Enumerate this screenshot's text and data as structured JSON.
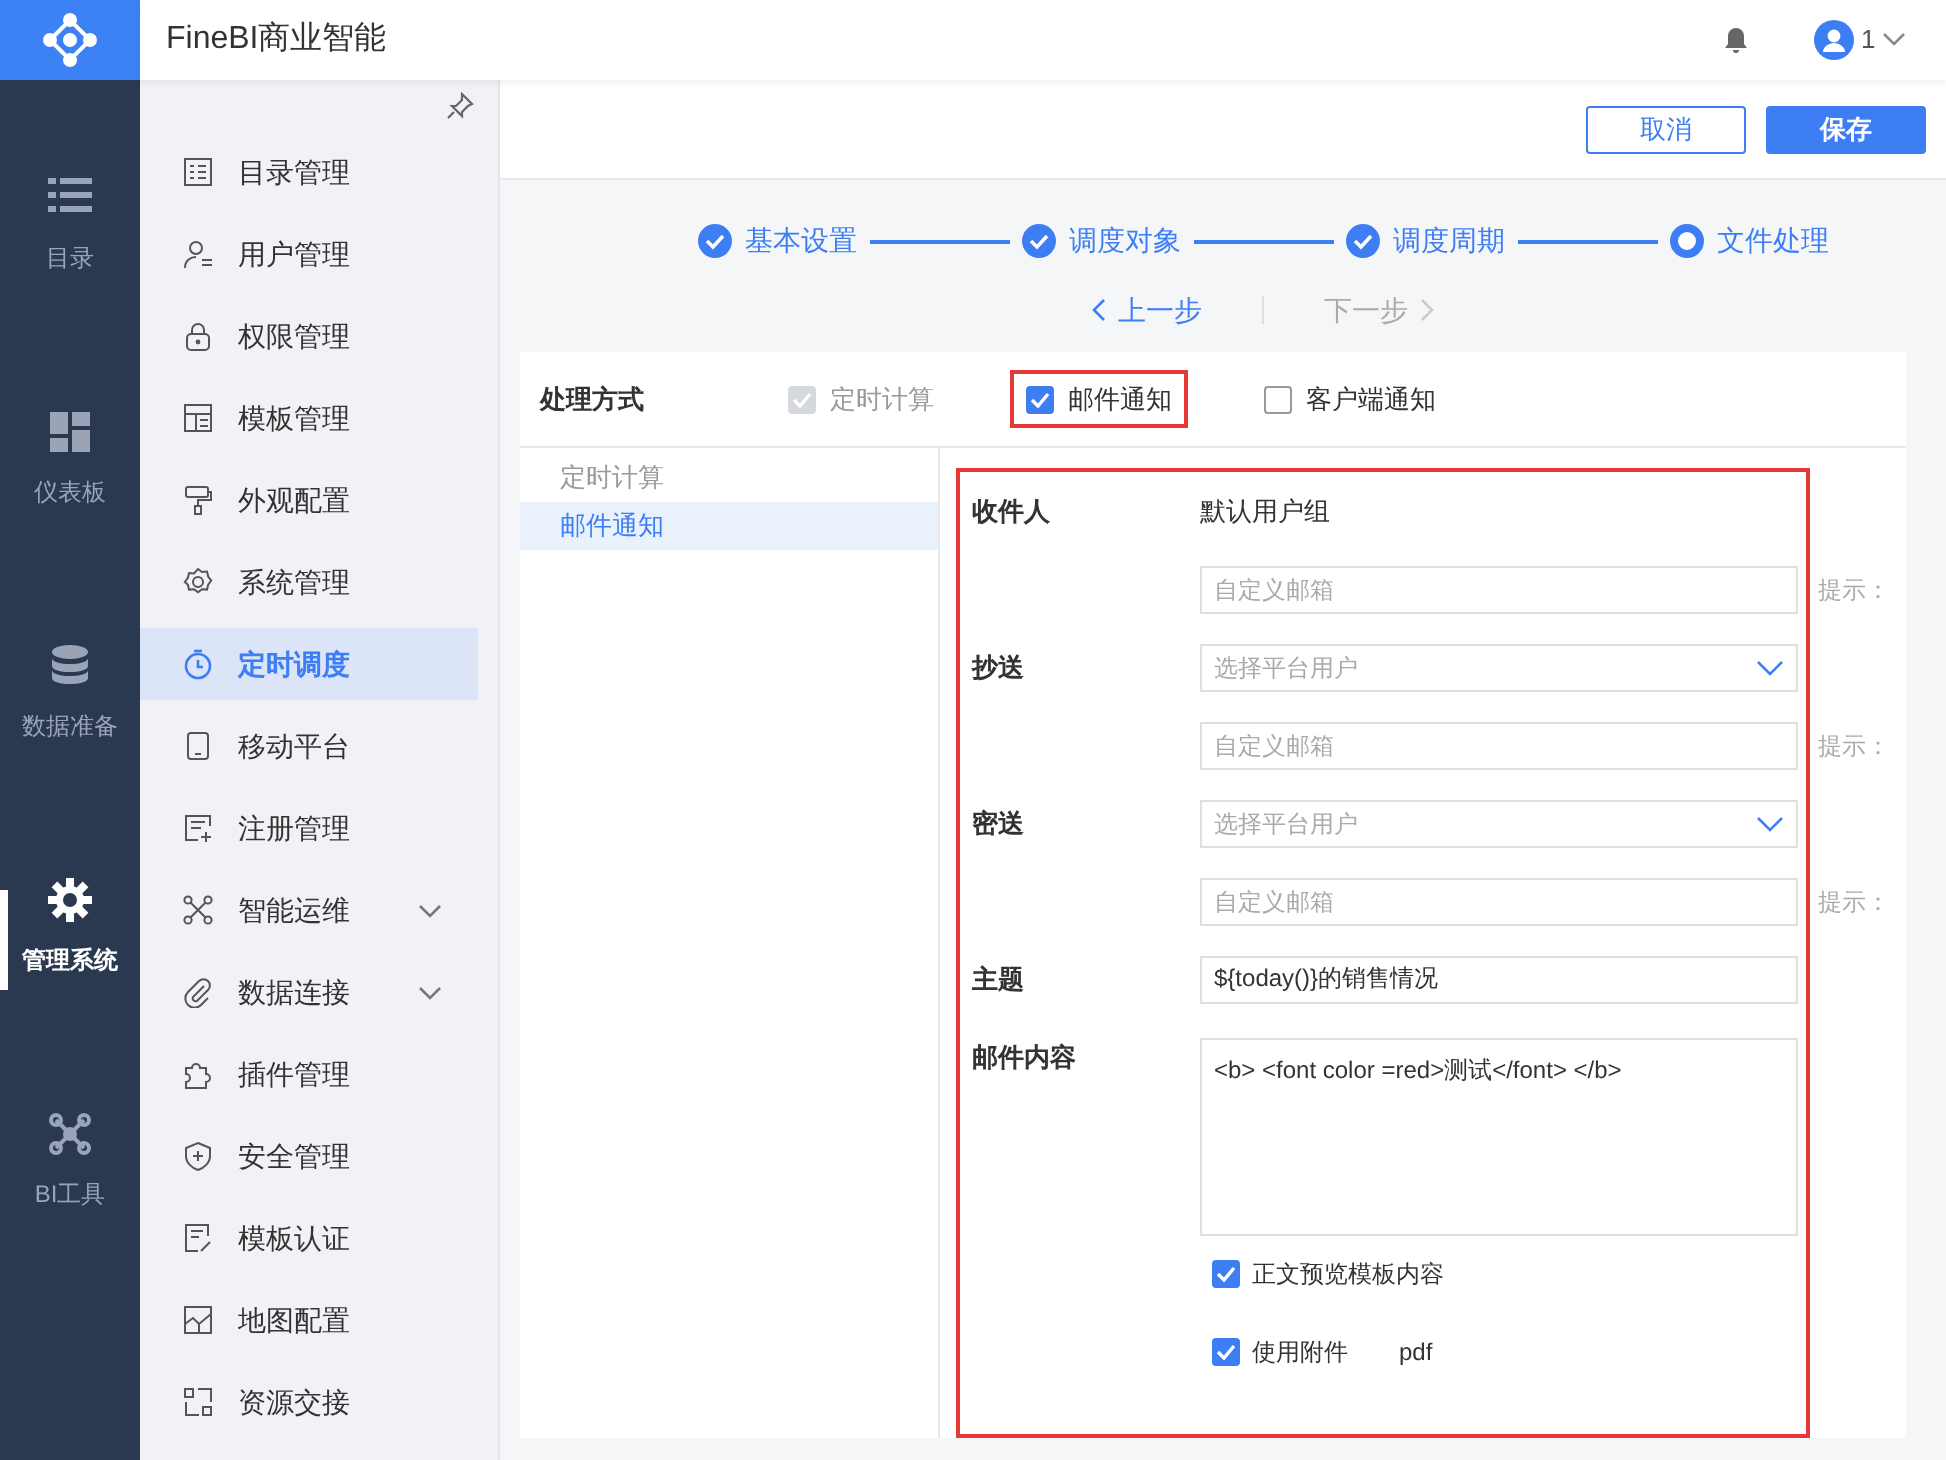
{
  "app": {
    "title": "FineBI商业智能",
    "user": "1"
  },
  "rail": [
    {
      "label": "目录",
      "selected": false
    },
    {
      "label": "仪表板",
      "selected": false
    },
    {
      "label": "数据准备",
      "selected": false
    },
    {
      "label": "管理系统",
      "selected": true
    },
    {
      "label": "BI工具",
      "selected": false
    }
  ],
  "menu": [
    {
      "label": "目录管理",
      "selected": false
    },
    {
      "label": "用户管理",
      "selected": false
    },
    {
      "label": "权限管理",
      "selected": false
    },
    {
      "label": "模板管理",
      "selected": false
    },
    {
      "label": "外观配置",
      "selected": false
    },
    {
      "label": "系统管理",
      "selected": false
    },
    {
      "label": "定时调度",
      "selected": true
    },
    {
      "label": "移动平台",
      "selected": false
    },
    {
      "label": "注册管理",
      "selected": false
    },
    {
      "label": "智能运维",
      "selected": false,
      "expandable": true
    },
    {
      "label": "数据连接",
      "selected": false,
      "expandable": true
    },
    {
      "label": "插件管理",
      "selected": false
    },
    {
      "label": "安全管理",
      "selected": false
    },
    {
      "label": "模板认证",
      "selected": false
    },
    {
      "label": "地图配置",
      "selected": false
    },
    {
      "label": "资源交接",
      "selected": false
    }
  ],
  "toolbar": {
    "buttons": [
      {
        "label": "取消",
        "kind": "outline"
      },
      {
        "label": "保存",
        "kind": "primary"
      }
    ]
  },
  "steps": [
    {
      "label": "基本设置",
      "done": true
    },
    {
      "label": "调度对象",
      "done": true
    },
    {
      "label": "调度周期",
      "done": true
    },
    {
      "label": "文件处理",
      "done": false
    }
  ],
  "step_nav": [
    {
      "label": "上一步",
      "disabled": false
    },
    {
      "label": "下一步",
      "disabled": true
    }
  ],
  "processing": {
    "label": "处理方式",
    "options": [
      {
        "label": "定时计算",
        "checked": true,
        "disabled": true,
        "highlighted": false
      },
      {
        "label": "邮件通知",
        "checked": true,
        "disabled": false,
        "highlighted": true
      },
      {
        "label": "客户端通知",
        "checked": false,
        "disabled": false,
        "highlighted": false
      }
    ]
  },
  "method_list": [
    {
      "label": "定时计算",
      "selected": false
    },
    {
      "label": "邮件通知",
      "selected": true
    }
  ],
  "form": [
    {
      "kind": "text",
      "label": "收件人",
      "value": "默认用户组"
    },
    {
      "kind": "input",
      "placeholder": "自定义邮箱",
      "hint": "提示："
    },
    {
      "kind": "select",
      "label": "抄送",
      "placeholder": "选择平台用户"
    },
    {
      "kind": "input",
      "placeholder": "自定义邮箱",
      "hint": "提示："
    },
    {
      "kind": "select",
      "label": "密送",
      "placeholder": "选择平台用户"
    },
    {
      "kind": "input",
      "placeholder": "自定义邮箱",
      "hint": "提示："
    },
    {
      "kind": "input",
      "label": "主题",
      "value": "${today()}的销售情况"
    },
    {
      "kind": "textarea",
      "label": "邮件内容",
      "value": "<b> <font color =red>测试</font> </b>"
    },
    {
      "kind": "checkbox",
      "text": "正文预览模板内容",
      "checked": true
    },
    {
      "kind": "checkbox",
      "text": "使用附件",
      "checked": true,
      "value": "pdf"
    }
  ]
}
